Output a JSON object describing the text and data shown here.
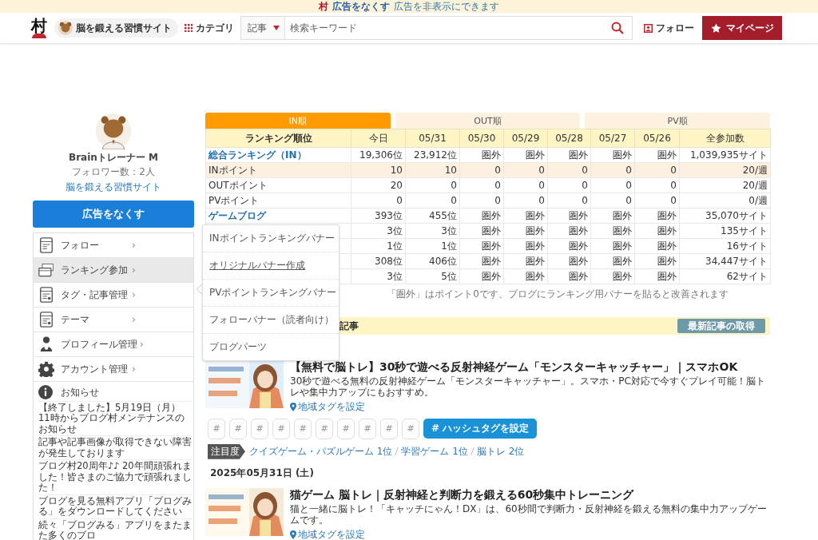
{
  "top_strip": {
    "logo": "村",
    "link": "広告をなくす",
    "note": "広告を非表示にできます"
  },
  "header": {
    "logo": "村",
    "site": "脳を鍛える習慣サイト",
    "category": "カテゴリ",
    "search_scope": "記事",
    "search_placeholder": "検索キーワード",
    "follow": "フォロー",
    "mypage": "マイページ"
  },
  "profile": {
    "name": "Brainトレーナー M",
    "followers": "フォロワー数：2人",
    "site": "脳を鍛える習慣サイト"
  },
  "remove_ads_button": "広告をなくす",
  "menu": [
    {
      "label": "フォロー",
      "kind": "reader",
      "selected": false,
      "chevron": "›"
    },
    {
      "label": "ランキング参加",
      "kind": "banner",
      "selected": true,
      "chevron": "›"
    },
    {
      "label": "タグ・記事管理",
      "kind": "post",
      "selected": false,
      "chevron": "›"
    },
    {
      "label": "テーマ",
      "kind": "theme",
      "selected": false,
      "chevron": "›"
    },
    {
      "label": "プロフィール管理",
      "kind": "profile",
      "selected": false,
      "chevron": "›"
    },
    {
      "label": "アカウント管理",
      "kind": "account",
      "selected": false,
      "chevron": "›"
    }
  ],
  "notices": {
    "title": "お知らせ",
    "items": [
      "【終了しました】5月19日（月）11時からブログ村メンテナンスのお知らせ",
      "記事や記事画像が取得できない障害が発生しております",
      "ブログ村20周年♪♪ 20年間頑張れました！皆さまのご協力で頑張れました！",
      "ブログを見る無料アプリ「ブログみる」をダウンロードしてください",
      "続々「ブログみる」アプリをまたまた多くのブロ"
    ]
  },
  "ranking": {
    "tabs": [
      {
        "label": "IN順",
        "selected": true
      },
      {
        "label": "OUT順",
        "selected": false
      },
      {
        "label": "PV順",
        "selected": false
      }
    ],
    "columns": [
      "ランキング順位",
      "今日",
      "05/31",
      "05/30",
      "05/29",
      "05/28",
      "05/27",
      "05/26",
      "全参加数"
    ],
    "rows": [
      {
        "kind": "link",
        "highlighted": false,
        "cells": [
          "総合ランキング（IN）",
          "19,306位",
          "23,912位",
          "圏外",
          "圏外",
          "圏外",
          "圏外",
          "圏外",
          "1,039,935サイト"
        ]
      },
      {
        "kind": "plain",
        "highlighted": true,
        "cells": [
          "INポイント",
          "10",
          "10",
          "0",
          "0",
          "0",
          "0",
          "0",
          "20/週"
        ]
      },
      {
        "kind": "plain",
        "highlighted": false,
        "cells": [
          "OUTポイント",
          "20",
          "0",
          "0",
          "0",
          "0",
          "0",
          "0",
          "20/週"
        ]
      },
      {
        "kind": "plain",
        "highlighted": false,
        "cells": [
          "PVポイント",
          "0",
          "0",
          "0",
          "0",
          "0",
          "0",
          "0",
          "0/週"
        ]
      },
      {
        "kind": "link",
        "highlighted": false,
        "cells": [
          "ゲームブログ",
          "393位",
          "455位",
          "圏外",
          "圏外",
          "圏外",
          "圏外",
          "圏外",
          "35,070サイト"
        ]
      },
      {
        "highlighted": false,
        "cells": [
          "",
          "3位",
          "3位",
          "圏外",
          "圏外",
          "圏外",
          "圏外",
          "圏外",
          "135サイト"
        ]
      },
      {
        "highlighted": false,
        "cells": [
          "",
          "1位",
          "1位",
          "圏外",
          "圏外",
          "圏外",
          "圏外",
          "圏外",
          "16サイト"
        ]
      },
      {
        "highlighted": false,
        "cells": [
          "",
          "308位",
          "406位",
          "圏外",
          "圏外",
          "圏外",
          "圏外",
          "圏外",
          "34,447サイト"
        ]
      },
      {
        "highlighted": false,
        "cells": [
          "",
          "3位",
          "5位",
          "圏外",
          "圏外",
          "圏外",
          "圏外",
          "圏外",
          "62サイト"
        ]
      }
    ],
    "note": "「圏外」はポイント0です、ブログにランキング用バナーを貼ると改善されます"
  },
  "articles_section": {
    "title": "記事",
    "fetch_button": "最新記事の取得"
  },
  "articles": [
    {
      "title": "【無料で脳トレ】30秒で遊べる反射神経ゲーム「モンスターキャッチャー」｜スマホOK",
      "description": "30秒で遊べる無料の反射神経ゲーム「モンスターキャッチャー」。スマホ・PC対応で今すぐプレイ可能！脳トレや集中力アップにもおすすめ。",
      "geo_tag": "地域タグを設定",
      "hashtags": [
        "#",
        "#",
        "#",
        "#",
        "#",
        "#",
        "#",
        "#",
        "#",
        "#"
      ],
      "hashtag_button": "# ハッシュタグを設定",
      "attention_label": "注目度",
      "attention": [
        "クイズゲーム・パズルゲーム 1位",
        "学習ゲーム 1位",
        "脳トレ 2位"
      ]
    },
    {
      "date": "2025年05月31日 (土)",
      "title": "猫ゲーム 脳トレ｜反射神経と判断力を鍛える60秒集中トレーニング",
      "description": "猫と一緒に脳トレ！「キャッチにゃん！DX」は、60秒間で判断力・反射神経を鍛える無料の集中力アップゲームです。",
      "geo_tag": "地域タグを設定"
    }
  ],
  "dropdown": [
    {
      "label": "INポイントランキングバナー",
      "hovered": false
    },
    {
      "label": "オリジナルバナー作成",
      "hovered": true
    },
    {
      "label": "PVポイントランキングバナー",
      "hovered": false
    },
    {
      "label": "フォローバナー（読者向け）",
      "hovered": false
    },
    {
      "label": "ブログパーツ",
      "hovered": false
    }
  ]
}
